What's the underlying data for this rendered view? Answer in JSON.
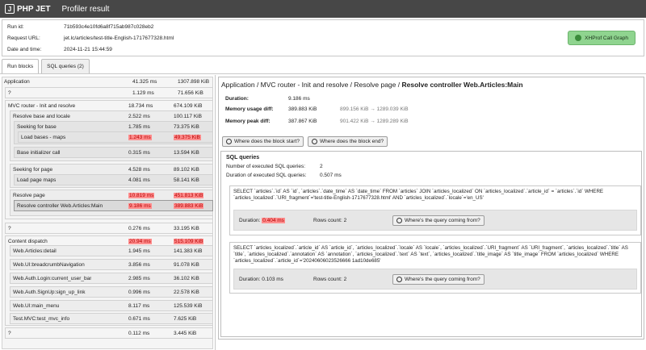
{
  "header": {
    "logo": "PHP JET",
    "title": "Profiler result"
  },
  "info": {
    "run_id_label": "Run id:",
    "run_id": "71b593c4e10fd6a8f715ab987c028eb2",
    "url_label": "Request URL:",
    "url": "jet.lc/articles/test-title-English-1717677328.html",
    "date_label": "Date and time:",
    "date": "2024-11-21 15:44:59",
    "xhprof_button": "XHProf Call Graph"
  },
  "tabs": {
    "run_blocks": "Run blocks",
    "sql_queries": "SQL queries (2)"
  },
  "blocks": [
    {
      "name": "Application",
      "duration": "41.325 ms",
      "memory": "1307.898 KiB"
    },
    {
      "name": "?",
      "duration": "1.129 ms",
      "memory": "71.656 KiB"
    },
    {
      "name": "MVC router - Init and resolve",
      "duration": "18.734 ms",
      "memory": "674.109 KiB"
    },
    {
      "name": "Resolve base and locale",
      "duration": "2.522 ms",
      "memory": "100.117 KiB"
    },
    {
      "name": "Seeking for base",
      "duration": "1.785 ms",
      "memory": "73.375 KiB"
    },
    {
      "name": "Load bases - maps",
      "duration": "1.243 ms",
      "memory": "49.375 KiB"
    },
    {
      "name": "Base initializer call",
      "duration": "0.315 ms",
      "memory": "13.594 KiB"
    },
    {
      "name": "Seeking for page",
      "duration": "4.528 ms",
      "memory": "89.102 KiB"
    },
    {
      "name": "Load page maps",
      "duration": "4.081 ms",
      "memory": "58.141 KiB"
    },
    {
      "name": "Resolve page",
      "duration": "10.819 ms",
      "memory": "451.813 KiB"
    },
    {
      "name": "Resolve controller Web.Articles:Main",
      "duration": "9.186 ms",
      "memory": "389.883 KiB"
    },
    {
      "name": "?",
      "duration": "0.276 ms",
      "memory": "33.195 KiB"
    },
    {
      "name": "Content dispatch",
      "duration": "20.94 ms",
      "memory": "515.109 KiB"
    },
    {
      "name": "Web.Articles:detail",
      "duration": "1.945 ms",
      "memory": "141.383 KiB"
    },
    {
      "name": "Web.UI:breadcrumbNavigation",
      "duration": "3.856 ms",
      "memory": "91.078 KiB"
    },
    {
      "name": "Web.Auth.Login:current_user_bar",
      "duration": "2.985 ms",
      "memory": "36.102 KiB"
    },
    {
      "name": "Web.Auth.SignUp:sign_up_link",
      "duration": "0.996 ms",
      "memory": "22.578 KiB"
    },
    {
      "name": "Web.UI:main_menu",
      "duration": "8.117 ms",
      "memory": "125.539 KiB"
    },
    {
      "name": "Test.MVC:test_mvc_info",
      "duration": "0.671 ms",
      "memory": "7.625 KiB"
    },
    {
      "name": "?",
      "duration": "0.112 ms",
      "memory": "3.445 KiB"
    }
  ],
  "detail": {
    "breadcrumb": "Application / MVC router - Init and resolve / Resolve page / ",
    "current": "Resolve controller Web.Articles:Main",
    "duration_label": "Duration:",
    "duration": "9.186 ms",
    "mem_usage_label": "Memory usage diff:",
    "mem_usage": "389.883 KiB",
    "mem_usage_range": "899.156 KiB → 1289.039 KiB",
    "mem_peak_label": "Memory peak diff:",
    "mem_peak": "387.867 KiB",
    "mem_peak_range": "901.422 KiB → 1289.289 KiB",
    "start_button": "Where does the block start?",
    "end_button": "Where does the block end?",
    "sql_title": "SQL queries",
    "sql_count_label": "Number of executed SQL queries:",
    "sql_count": "2",
    "sql_duration_label": "Duration of executed SQL queries:",
    "sql_duration": "0.507 ms",
    "queries": [
      {
        "text": "SELECT `articles`.`id` AS `id`, `articles`.`date_time` AS `date_time` FROM `articles` JOIN `articles_localized` ON `articles_localized`.`article_id` = `articles`.`id` WHERE `articles_localized`.`URI_fragment`='test-title-English-1717677328.html' AND `articles_localized`.`locale`='en_US'",
        "duration_label": "Duration:",
        "duration": "0.404 ms",
        "rows": "Rows count: 2",
        "origin_button": "Where's the query coming from?"
      },
      {
        "text": "SELECT `articles_localized`.`article_id` AS `article_id`, `articles_localized`.`locale` AS `locale`, `articles_localized`.`URI_fragment` AS `URI_fragment`, `articles_localized`.`title` AS `title`, `articles_localized`.`annotation` AS `annotation`, `articles_localized`.`text` AS `text`, `articles_localized`.`title_image` AS `title_image` FROM `articles_localized` WHERE `articles_localized`.`article_id`='20240606023526666 1ad10de685'",
        "duration_label": "Duration:",
        "duration": "0.103 ms",
        "rows": "Rows count: 2",
        "origin_button": "Where's the query coming from?"
      }
    ]
  },
  "colors": {
    "topbar": "#474747",
    "highlight": "#ff8f8f",
    "xhprof": "#8fd48f"
  }
}
